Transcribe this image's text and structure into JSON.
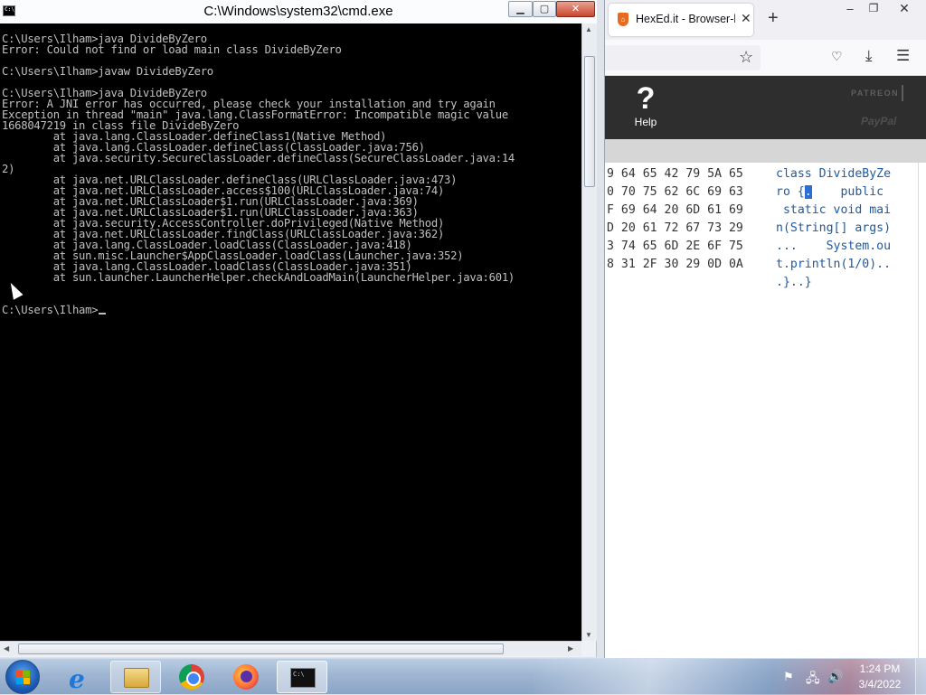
{
  "cmd": {
    "title": "C:\\Windows\\system32\\cmd.exe",
    "icon_text": "C:\\",
    "lines": [
      "C:\\Users\\Ilham>java DivideByZero",
      "Error: Could not find or load main class DivideByZero",
      "",
      "C:\\Users\\Ilham>javaw DivideByZero",
      "",
      "C:\\Users\\Ilham>java DivideByZero",
      "Error: A JNI error has occurred, please check your installation and try again",
      "Exception in thread \"main\" java.lang.ClassFormatError: Incompatible magic value",
      "1668047219 in class file DivideByZero",
      "        at java.lang.ClassLoader.defineClass1(Native Method)",
      "        at java.lang.ClassLoader.defineClass(ClassLoader.java:756)",
      "        at java.security.SecureClassLoader.defineClass(SecureClassLoader.java:14",
      "2)",
      "        at java.net.URLClassLoader.defineClass(URLClassLoader.java:473)",
      "        at java.net.URLClassLoader.access$100(URLClassLoader.java:74)",
      "        at java.net.URLClassLoader$1.run(URLClassLoader.java:369)",
      "        at java.net.URLClassLoader$1.run(URLClassLoader.java:363)",
      "        at java.security.AccessController.doPrivileged(Native Method)",
      "        at java.net.URLClassLoader.findClass(URLClassLoader.java:362)",
      "        at java.lang.ClassLoader.loadClass(ClassLoader.java:418)",
      "        at sun.misc.Launcher$AppClassLoader.loadClass(Launcher.java:352)",
      "        at java.lang.ClassLoader.loadClass(ClassLoader.java:351)",
      "        at sun.launcher.LauncherHelper.checkAndLoadMain(LauncherHelper.java:601)",
      "",
      ""
    ],
    "prompt": "C:\\Users\\Ilham>"
  },
  "browser": {
    "tab_title": "HexEd.it - Browser-based",
    "help_icon": "?",
    "help_label": "Help",
    "patreon_label": "PATREON",
    "paypal_label": "PayPal",
    "hex_rows": [
      "9 64 65 42 79 5A 65",
      "0 70 75 62 6C 69 63",
      "F 69 64 20 6D 61 69",
      "D 20 61 72 67 73 29",
      "3 74 65 6D 2E 6F 75",
      "8 31 2F 30 29 0D 0A"
    ],
    "ascii_rows": [
      "class DivideByZe",
      "ro {",
      " static void mai",
      "n(String[] args)",
      "...    System.ou",
      "t.println(1/0).."
    ],
    "ascii_row2_selected": ".",
    "ascii_row2_rest": "    public",
    "ascii_last": ".}..}"
  },
  "icons": {
    "star": "star-icon",
    "pocket": "pocket-icon",
    "download": "download-icon",
    "menu": "hamburger-menu-icon"
  },
  "taskbar": {
    "time": "1:24 PM",
    "date": "3/4/2022"
  },
  "colors": {
    "console_bg": "#000000",
    "console_fg": "#c0c0c0",
    "selection": "#2b6fd6",
    "hexed_header": "#2e2e2e"
  }
}
